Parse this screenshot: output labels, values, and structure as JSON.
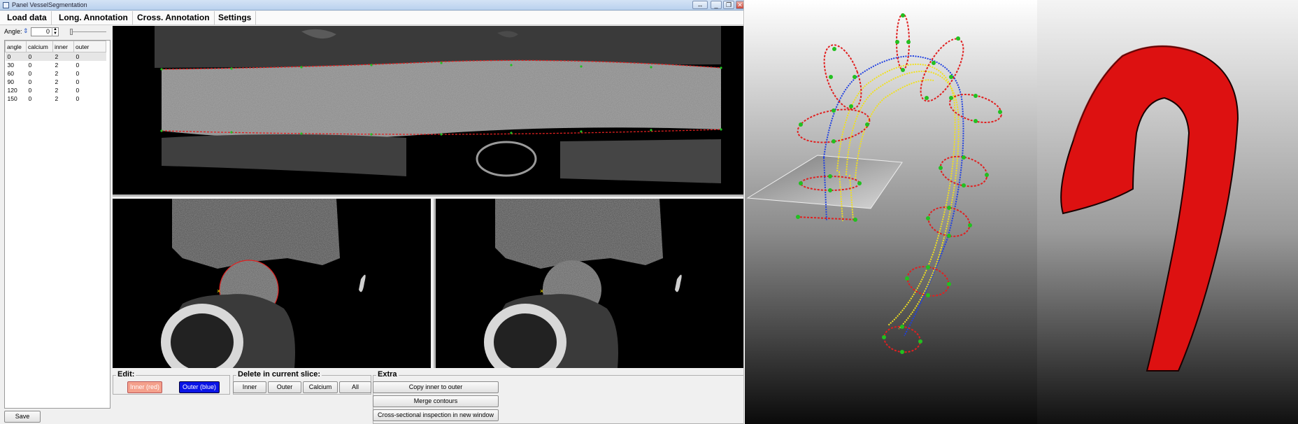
{
  "window": {
    "title": "Panel VesselSegmentation",
    "buttons": [
      "↔",
      "_",
      "❐",
      "✕"
    ]
  },
  "menu": {
    "items": [
      "Load data",
      "Long. Annotation",
      "Cross. Annotation",
      "Settings"
    ]
  },
  "angle": {
    "label": "Angle:",
    "value": "0"
  },
  "table": {
    "headers": [
      "angle",
      "calcium",
      "inner",
      "outer"
    ],
    "rows": [
      [
        "0",
        "0",
        "2",
        "0"
      ],
      [
        "30",
        "0",
        "2",
        "0"
      ],
      [
        "60",
        "0",
        "2",
        "0"
      ],
      [
        "90",
        "0",
        "2",
        "0"
      ],
      [
        "120",
        "0",
        "2",
        "0"
      ],
      [
        "150",
        "0",
        "2",
        "0"
      ]
    ]
  },
  "edit": {
    "title": "Edit:",
    "inner_label": "Inner (red)",
    "outer_label": "Outer (blue)",
    "inner_color": "#f4a08c",
    "outer_color": "#0a14e6"
  },
  "delete": {
    "title": "Delete in current slice:",
    "inner": "Inner",
    "outer": "Outer",
    "calcium": "Calcium",
    "all": "All"
  },
  "extra": {
    "title": "Extra",
    "copy": "Copy inner to outer",
    "merge": "Merge contours",
    "cross": "Cross-sectional inspection in new window"
  },
  "save_label": "Save",
  "colors": {
    "inner_contour": "#e02020",
    "control_point": "#22c020",
    "centerline": "#2040e0",
    "outer_wall": "#f0e020",
    "mesh": "#dd1111"
  }
}
